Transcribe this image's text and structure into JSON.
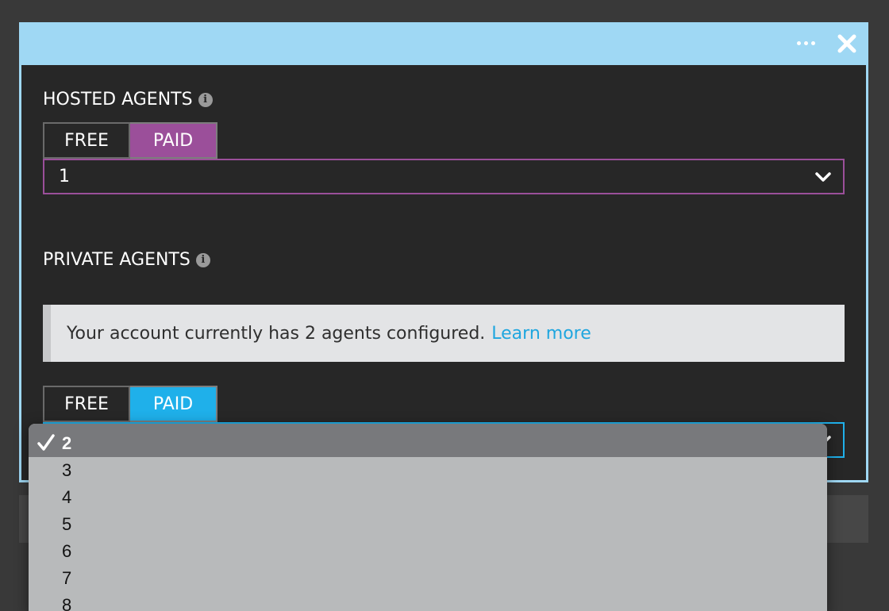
{
  "hosted": {
    "title": "HOSTED AGENTS",
    "toggle": {
      "free_label": "FREE",
      "paid_label": "PAID",
      "selected": "PAID"
    },
    "select_value": "1"
  },
  "private": {
    "title": "PRIVATE AGENTS",
    "notice_text": "Your account currently has 2 agents configured.",
    "notice_link": "Learn more",
    "toggle": {
      "free_label": "FREE",
      "paid_label": "PAID",
      "selected": "PAID"
    }
  },
  "dropdown": {
    "selected": "2",
    "options": [
      "2",
      "3",
      "4",
      "5",
      "6",
      "7",
      "8"
    ]
  },
  "colors": {
    "header": "#9fd8f4",
    "panel": "#272727",
    "paid_purple": "#9b4f9a",
    "paid_blue": "#1fb0ea",
    "link": "#1fa6df"
  },
  "icons": {
    "more": "more-horizontal-icon",
    "close": "close-icon",
    "info": "info-icon",
    "chevron": "chevron-down-icon",
    "check": "checkmark-icon"
  }
}
